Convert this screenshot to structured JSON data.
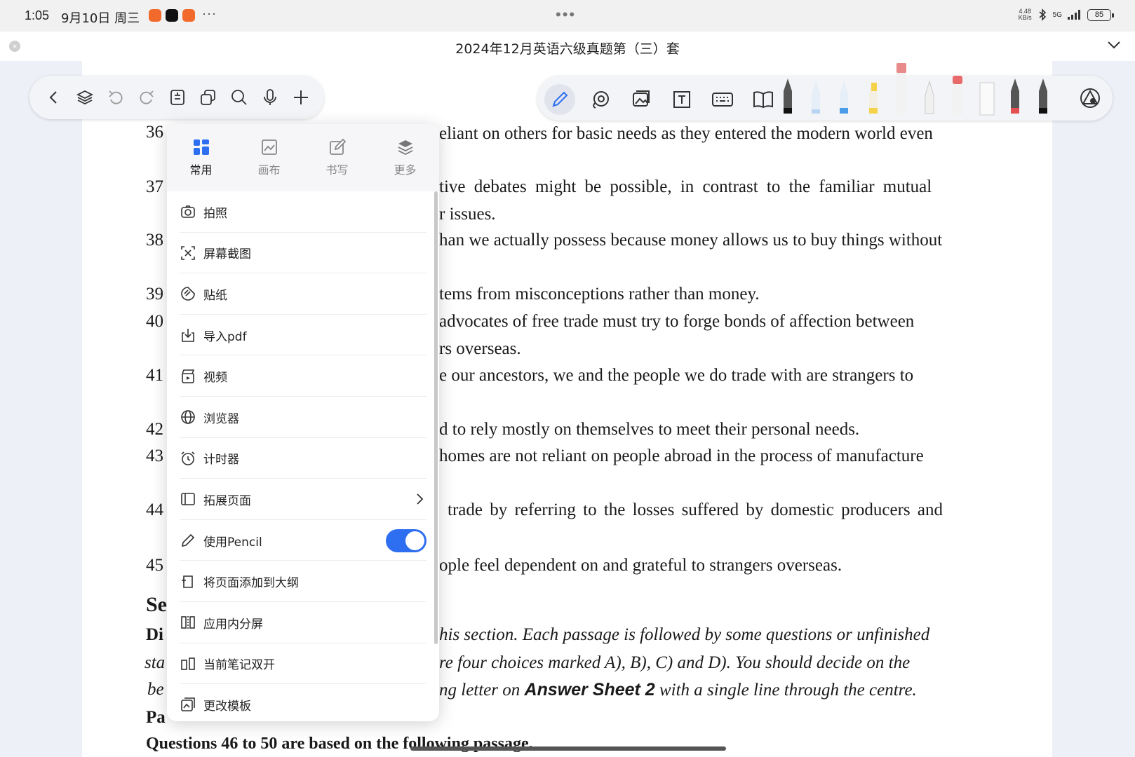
{
  "status_bar": {
    "time": "1:05",
    "date": "9月10日 周三",
    "more": "···",
    "center_dots": "•••",
    "net_speed_value": "4.48",
    "net_speed_unit": "KB/s",
    "network": "5G",
    "battery": "85"
  },
  "title_bar": {
    "close_glyph": "×",
    "title": "2024年12月英语六级真题第（三）套"
  },
  "colors": {
    "accent_blue": "#2d6ff0",
    "toggle_on": "#2d6ff0",
    "app_icon_1": "#f26a2b",
    "app_icon_2": "#111111",
    "app_icon_3": "#f26a2b"
  },
  "left_toolbar": {
    "icons": [
      "back-icon",
      "layers-icon",
      "undo-icon",
      "redo-icon",
      "outline-icon",
      "copy-icon",
      "search-icon",
      "microphone-icon",
      "add-icon"
    ]
  },
  "right_toolbar": {
    "icons": [
      "pen-tool-icon",
      "lasso-icon",
      "image-icon",
      "textbox-icon",
      "keyboard-icon",
      "book-icon"
    ],
    "pens": [
      "fountain-pen-black",
      "pencil-blue-light",
      "pencil-blue",
      "highlighter-yellow",
      "eraser-pink",
      "pencil-grey",
      "eraser-red",
      "ruler",
      "fountain-pen-red",
      "fountain-pen-black-2"
    ],
    "end_icon": "palette-icon"
  },
  "document": {
    "question_numbers": [
      "36",
      "37",
      "38",
      "39",
      "40",
      "41",
      "42",
      "43",
      "44",
      "45"
    ],
    "lines": [
      "eliant on others for basic needs as they entered the modern world even",
      "tive debates might be possible, in contrast to the familiar mutual",
      "r issues.",
      "han we actually possess because money allows us to buy things without",
      "tems from misconceptions rather than money.",
      "advocates of free trade must try to forge bonds of affection between",
      "rs overseas.",
      "e our ancestors, we and the people we do trade with are strangers to",
      "d to rely mostly on themselves to meet their personal needs.",
      "homes are not reliant on people abroad in the process of manufacture",
      "trade by referring to the losses suffered by domestic producers and",
      "ople feel dependent on and grateful to strangers overseas."
    ],
    "section_fragment": "Se",
    "directions_fragment": "Di",
    "sta_fragment": "sta",
    "be_fragment": "be",
    "passage_fragment": "Pa",
    "directions_lines": [
      "his section. Each passage is followed by some questions or unfinished",
      "re four choices marked A), B), C) and D). You should decide on the"
    ],
    "directions_line3_pre": "ng letter on ",
    "answer_sheet": "Answer Sheet 2",
    "directions_line3_post": " with a single line through the centre.",
    "questions_line": "Questions 46 to 50 are based on the following passage."
  },
  "popup": {
    "tabs": [
      {
        "label": "常用",
        "icon": "grid-icon",
        "active": true
      },
      {
        "label": "画布",
        "icon": "canvas-icon",
        "active": false
      },
      {
        "label": "书写",
        "icon": "edit-icon",
        "active": false
      },
      {
        "label": "更多",
        "icon": "stack-icon",
        "active": false
      }
    ],
    "items": [
      {
        "label": "拍照",
        "icon": "camera-icon"
      },
      {
        "label": "屏幕截图",
        "icon": "screenshot-icon"
      },
      {
        "label": "贴纸",
        "icon": "sticker-icon"
      },
      {
        "label": "导入pdf",
        "icon": "import-icon"
      },
      {
        "label": "视频",
        "icon": "video-icon"
      },
      {
        "label": "浏览器",
        "icon": "globe-icon"
      },
      {
        "label": "计时器",
        "icon": "alarm-icon"
      },
      {
        "label": "拓展页面",
        "icon": "expand-page-icon",
        "chevron": true
      },
      {
        "label": "使用Pencil",
        "icon": "pencil-icon",
        "toggle": true,
        "toggle_on": true
      },
      {
        "label": "将页面添加到大纲",
        "icon": "add-outline-icon"
      },
      {
        "label": "应用内分屏",
        "icon": "split-screen-icon"
      },
      {
        "label": "当前笔记双开",
        "icon": "dual-open-icon"
      },
      {
        "label": "更改模板",
        "icon": "template-icon"
      }
    ]
  }
}
